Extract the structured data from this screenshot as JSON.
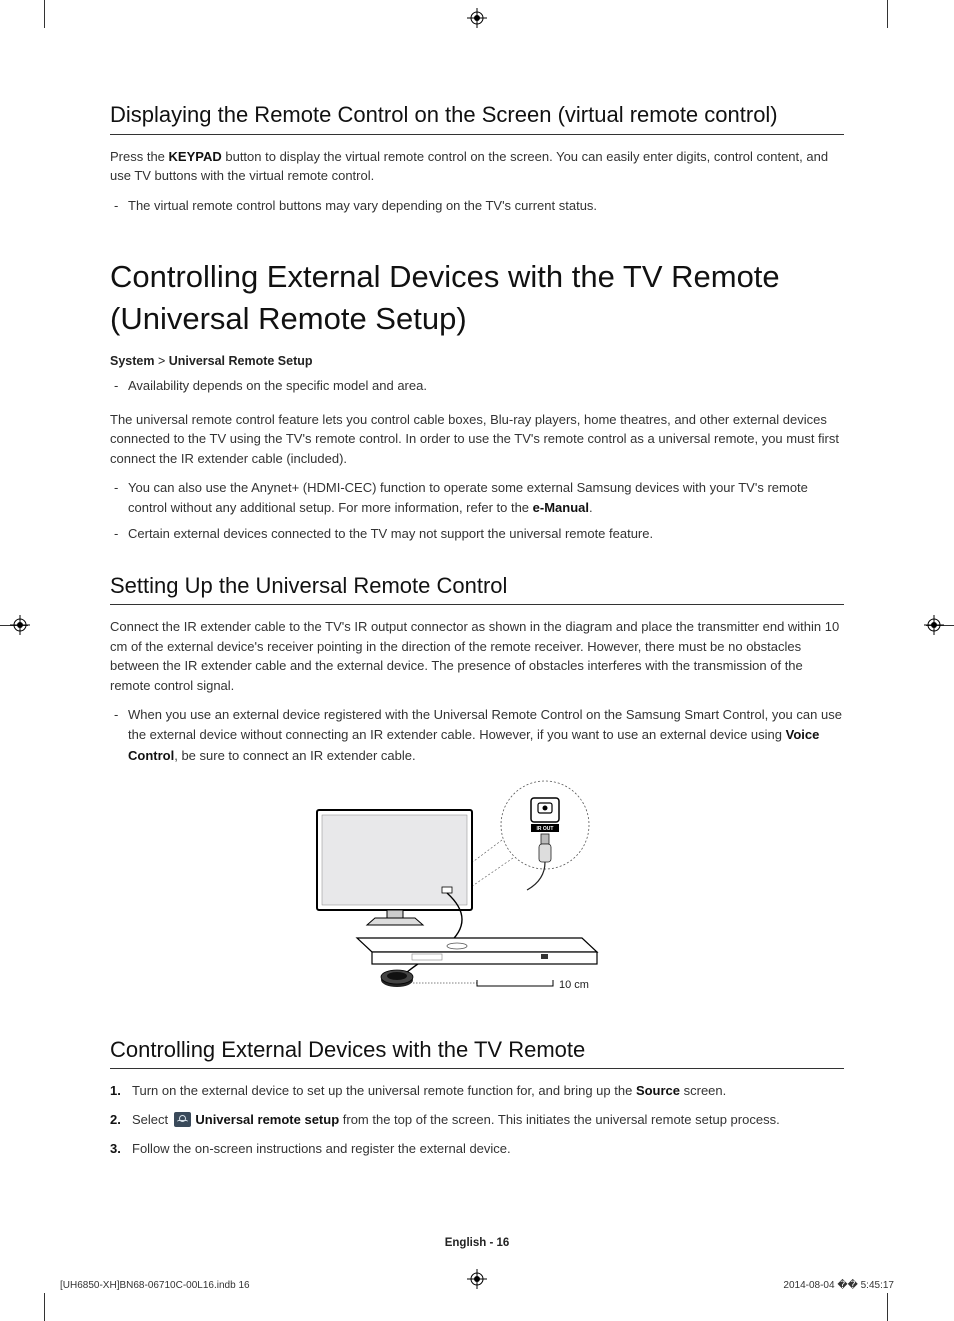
{
  "section1": {
    "heading": "Displaying the Remote Control on the Screen (virtual remote control)",
    "p1_pre": "Press the ",
    "p1_bold": "KEYPAD",
    "p1_post": " button to display the virtual remote control on the screen. You can easily enter digits, control content, and use TV buttons with the virtual remote control.",
    "note1": "The virtual remote control buttons may vary depending on the TV's current status."
  },
  "major": {
    "heading": "Controlling External Devices with the TV Remote (Universal Remote Setup)",
    "path_b1": "System",
    "path_gt": " > ",
    "path_b2": "Universal Remote Setup",
    "note1": "Availability depends on the specific model and area.",
    "p1": "The universal remote control feature lets you control cable boxes, Blu-ray players, home theatres, and other external devices connected to the TV using the TV's remote control. In order to use the TV's remote control as a universal remote, you must first connect the IR extender cable (included).",
    "note2_pre": "You can also use the Anynet+ (HDMI-CEC) function to operate some external Samsung devices with your TV's remote control without any additional setup. For more information, refer to the ",
    "note2_bold": "e-Manual",
    "note2_post": ".",
    "note3": "Certain external devices connected to the TV may not support the universal remote feature."
  },
  "section2": {
    "heading": "Setting Up the Universal Remote Control",
    "p1": "Connect the IR extender cable to the TV's IR output connector as shown in the diagram and place the transmitter end within 10 cm of the external device's receiver pointing in the direction of the remote receiver. However, there must be no obstacles between the IR extender cable and the external device. The presence of obstacles interferes with the transmission of the remote control signal.",
    "note1_pre": "When you use an external device registered with the Universal Remote Control on the Samsung Smart Control, you can use the external device without connecting an IR extender cable. However, if you want to use an external device using ",
    "note1_bold": "Voice Control",
    "note1_post": ", be sure to connect an IR extender cable.",
    "diagram_label_irout": "IR OUT",
    "diagram_label_10cm": "10 cm"
  },
  "section3": {
    "heading": "Controlling External Devices with the TV Remote",
    "step1_pre": "Turn on the external device to set up the universal remote function for, and bring up the ",
    "step1_bold": "Source",
    "step1_post": " screen.",
    "step2_pre": "Select ",
    "step2_bold": " Universal remote setup",
    "step2_post": " from the top of the screen. This initiates the universal remote setup process.",
    "step3": "Follow the on-screen instructions and register the external device."
  },
  "footer": {
    "center": "English - 16",
    "left": "[UH6850-XH]BN68-06710C-00L16.indb   16",
    "right": "2014-08-04   �� 5:45:17"
  }
}
